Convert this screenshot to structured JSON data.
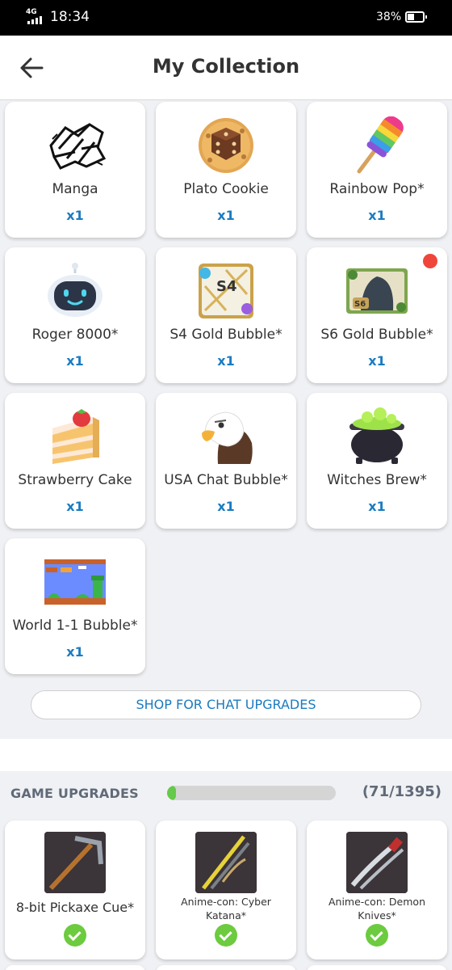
{
  "status_bar": {
    "network": "4G",
    "time": "18:34",
    "battery": "38%"
  },
  "header": {
    "title": "My Collection"
  },
  "collection": [
    {
      "name": "Manga",
      "qty": "x1",
      "icon": "manga-shards-icon"
    },
    {
      "name": "Plato Cookie",
      "qty": "x1",
      "icon": "dice-cookie-icon"
    },
    {
      "name": "Rainbow Pop*",
      "qty": "x1",
      "icon": "rainbow-popsicle-icon"
    },
    {
      "name": "Roger 8000*",
      "qty": "x1",
      "icon": "robot-icon"
    },
    {
      "name": "S4 Gold Bubble*",
      "qty": "x1",
      "icon": "s4-gold-bubble-icon"
    },
    {
      "name": "S6 Gold Bubble*",
      "qty": "x1",
      "icon": "s6-gold-bubble-icon"
    },
    {
      "name": "Strawberry Cake",
      "qty": "x1",
      "icon": "strawberry-cake-icon"
    },
    {
      "name": "USA Chat Bubble*",
      "qty": "x1",
      "icon": "eagle-icon"
    },
    {
      "name": "Witches Brew*",
      "qty": "x1",
      "icon": "cauldron-icon"
    },
    {
      "name": "World 1-1 Bubble*",
      "qty": "x1",
      "icon": "pixel-world-icon"
    }
  ],
  "shop_button": "SHOP FOR CHAT UPGRADES",
  "game_upgrades": {
    "title": "GAME UPGRADES",
    "progress_count": "(71/1395)",
    "progress_fraction": 0.051,
    "items": [
      {
        "name": "8-bit Pickaxe Cue*",
        "icon": "pickaxe-cue-icon"
      },
      {
        "name": "Anime-con: Cyber Katana*",
        "icon": "cyber-katana-icon"
      },
      {
        "name": "Anime-con: Demon Knives*",
        "icon": "demon-knives-icon"
      }
    ]
  },
  "colors": {
    "accent": "#1a7bc0",
    "check": "#6ccb3e",
    "progress": "#65c94a",
    "notification": "#f0453a"
  }
}
